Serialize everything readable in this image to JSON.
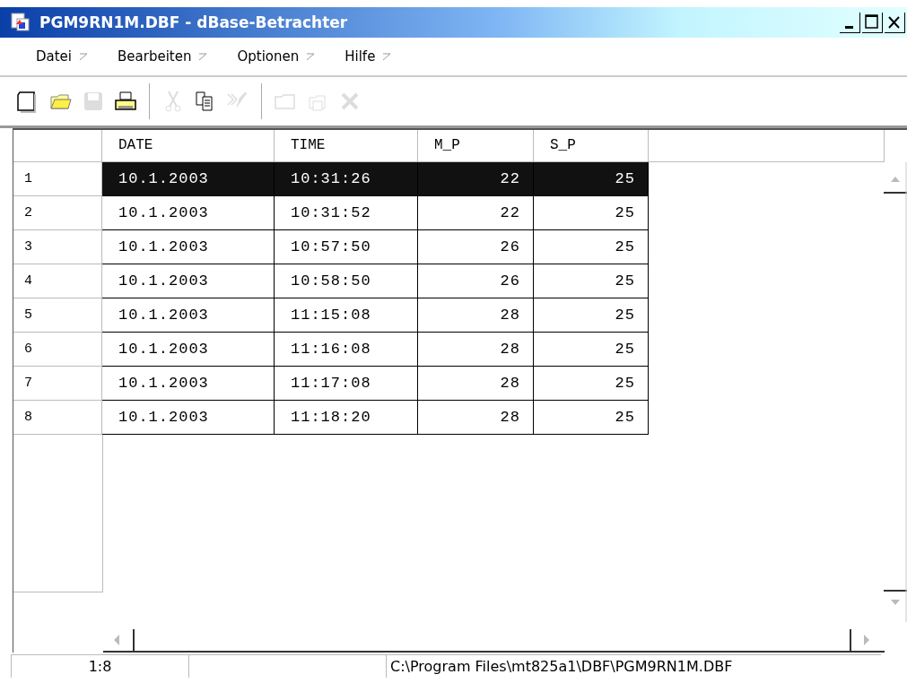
{
  "window": {
    "title": "PGM9RN1M.DBF - dBase-Betrachter"
  },
  "menu": [
    {
      "label": "Datei"
    },
    {
      "label": "Bearbeiten"
    },
    {
      "label": "Optionen"
    },
    {
      "label": "Hilfe"
    }
  ],
  "toolbar": [
    {
      "kind": "new",
      "disabled": false
    },
    {
      "kind": "open",
      "disabled": false
    },
    {
      "kind": "save",
      "disabled": true
    },
    {
      "kind": "print",
      "disabled": false
    },
    {
      "kind": "separator"
    },
    {
      "kind": "cut",
      "disabled": true
    },
    {
      "kind": "copy",
      "disabled": false
    },
    {
      "kind": "paste",
      "disabled": true
    },
    {
      "kind": "separator"
    },
    {
      "kind": "folder",
      "disabled": true
    },
    {
      "kind": "files",
      "disabled": true
    },
    {
      "kind": "delete",
      "disabled": true
    }
  ],
  "table": {
    "columns": [
      "DATE",
      "TIME",
      "M_P",
      "S_P"
    ],
    "rows": [
      {
        "number": "1",
        "cells": [
          "10.1.2003",
          "10:31:26",
          "22",
          "25"
        ],
        "selected": true
      },
      {
        "number": "2",
        "cells": [
          "10.1.2003",
          "10:31:52",
          "22",
          "25"
        ],
        "selected": false
      },
      {
        "number": "3",
        "cells": [
          "10.1.2003",
          "10:57:50",
          "26",
          "25"
        ],
        "selected": false
      },
      {
        "number": "4",
        "cells": [
          "10.1.2003",
          "10:58:50",
          "26",
          "25"
        ],
        "selected": false
      },
      {
        "number": "5",
        "cells": [
          "10.1.2003",
          "11:15:08",
          "28",
          "25"
        ],
        "selected": false
      },
      {
        "number": "6",
        "cells": [
          "10.1.2003",
          "11:16:08",
          "28",
          "25"
        ],
        "selected": false
      },
      {
        "number": "7",
        "cells": [
          "10.1.2003",
          "11:17:08",
          "28",
          "25"
        ],
        "selected": false
      },
      {
        "number": "8",
        "cells": [
          "10.1.2003",
          "11:18:20",
          "28",
          "25"
        ],
        "selected": false
      }
    ]
  },
  "status_bar": {
    "position": "1:8",
    "path": "C:\\Program Files\\mt825a1\\DBF\\PGM9RN1M.DBF"
  }
}
